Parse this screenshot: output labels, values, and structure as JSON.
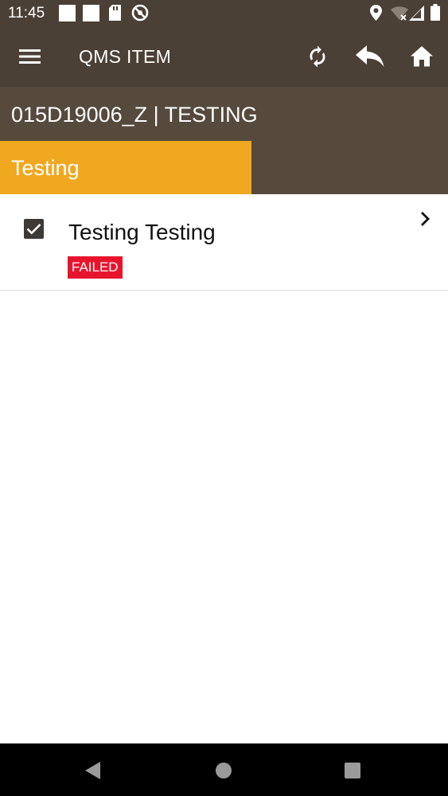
{
  "status_bar": {
    "time": "11:45",
    "left_icons": [
      "notification-square-icon",
      "notification-square-icon",
      "sd-card-icon",
      "do-not-disturb-icon"
    ],
    "right_icons": [
      "location-icon",
      "wifi-off-icon",
      "signal-icon",
      "battery-icon"
    ]
  },
  "app_bar": {
    "title": "QMS ITEM",
    "icons": [
      "menu-icon",
      "sync-icon",
      "reply-icon",
      "home-icon"
    ]
  },
  "record": {
    "title": "015D19006_Z | TESTING"
  },
  "tabs": [
    {
      "label": "Testing",
      "active": true
    },
    {
      "label": "",
      "active": false
    }
  ],
  "items": [
    {
      "title": "Testing Testing",
      "badge": "FAILED",
      "checked": true
    }
  ],
  "colors": {
    "app_bar": "#4a4035",
    "subheader": "#564a3d",
    "tab_active": "#f0a820",
    "badge_failed": "#e8142e",
    "nav_bar": "#000000"
  }
}
